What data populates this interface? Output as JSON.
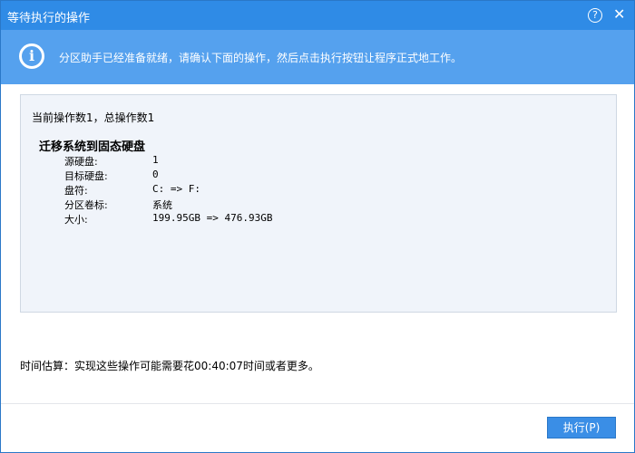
{
  "window": {
    "title": "等待执行的操作",
    "help_icon": "?",
    "close_icon": "✕"
  },
  "banner": {
    "icon": "i",
    "text": "分区助手已经准备就绪，请确认下面的操作，然后点击执行按钮让程序正式地工作。"
  },
  "panel": {
    "summary": "当前操作数1，总操作数1",
    "operation_title": "迁移系统到固态硬盘",
    "rows": [
      {
        "label": "源硬盘:",
        "value": "1"
      },
      {
        "label": "目标硬盘:",
        "value": "0"
      },
      {
        "label": "盘符:",
        "value": "C: => F:"
      },
      {
        "label": "分区卷标:",
        "value": "系统"
      },
      {
        "label": "大小:",
        "value": "199.95GB => 476.93GB"
      }
    ]
  },
  "estimate": "时间估算：实现这些操作可能需要花00:40:07时间或者更多。",
  "execute_label": "执行(P)"
}
